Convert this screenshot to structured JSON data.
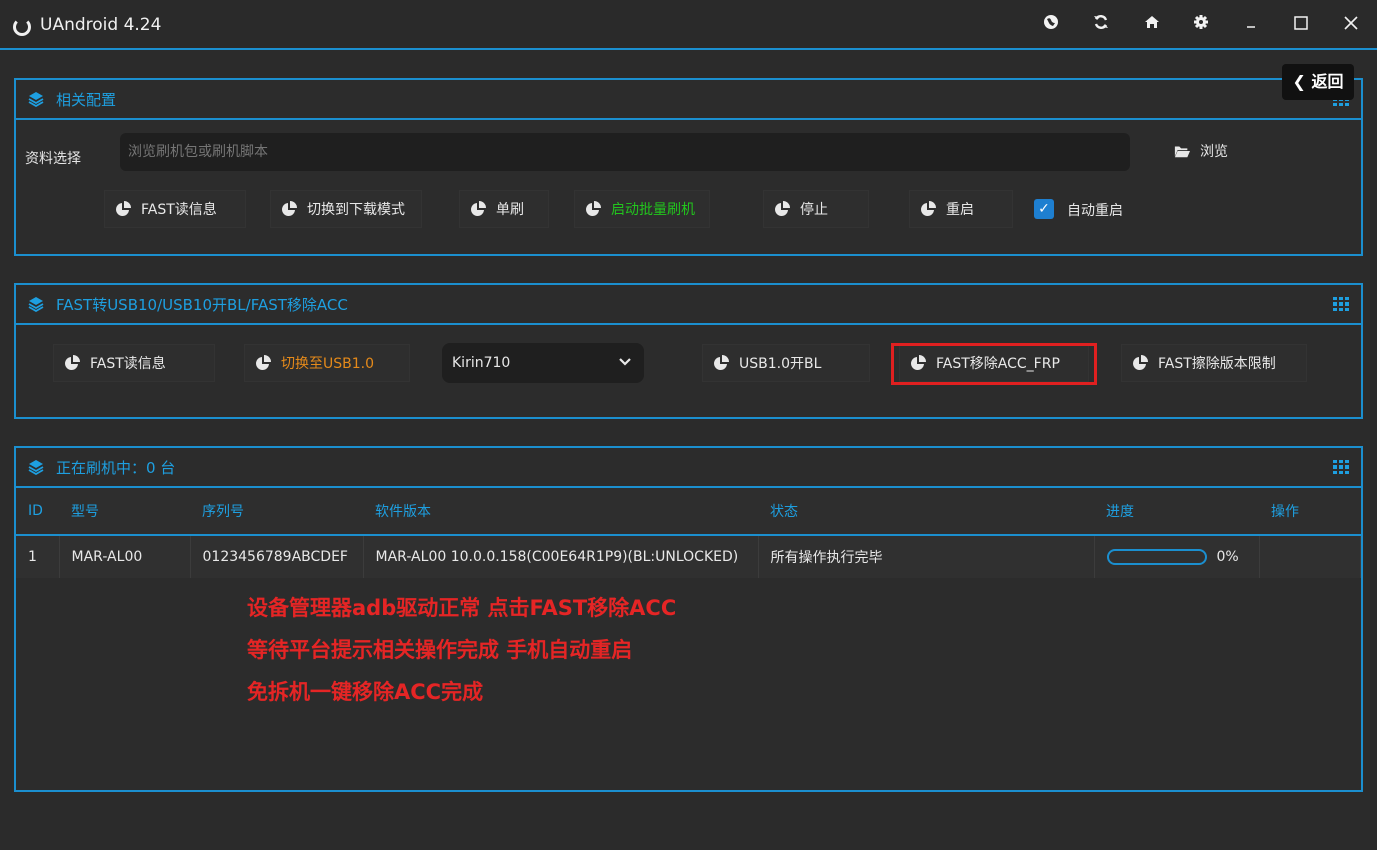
{
  "window": {
    "title": "UAndroid 4.24",
    "controls": [
      "globe-icon",
      "refresh-icon",
      "home-icon",
      "gear-icon",
      "minimize-icon",
      "maximize-icon",
      "close-icon"
    ]
  },
  "back_button": {
    "label": "返回"
  },
  "config_panel": {
    "title": "相关配置",
    "file_label": "资料选择",
    "file_placeholder": "浏览刷机包或刷机脚本",
    "browse_label": "浏览",
    "buttons": [
      "FAST读信息",
      "切换到下载模式",
      "单刷",
      "启动批量刷机",
      "停止",
      "重启"
    ],
    "auto_restart_label": "自动重启",
    "auto_restart_checked": true
  },
  "fast_panel": {
    "title": "FAST转USB10/USB10开BL/FAST移除ACC",
    "buttons": [
      "FAST读信息",
      "切换至USB1.0",
      "USB1.0开BL",
      "FAST移除ACC_FRP",
      "FAST擦除版本限制"
    ],
    "chip_select_value": "Kirin710"
  },
  "flash_panel": {
    "title": "正在刷机中：0 台",
    "columns": [
      "ID",
      "型号",
      "序列号",
      "软件版本",
      "状态",
      "进度",
      "操作"
    ],
    "rows": [
      {
        "id": "1",
        "model": "MAR-AL00",
        "serial": "0123456789ABCDEF",
        "version": "MAR-AL00 10.0.0.158(C00E64R1P9)(BL:UNLOCKED)",
        "status": "所有操作执行完毕",
        "progress_text": "0%",
        "progress_fraction": 0,
        "action": ""
      }
    ]
  },
  "annotations": [
    "设备管理器adb驱动正常 点击FAST移除ACC",
    "等待平台提示相关操作完成 手机自动重启",
    "免拆机一键移除ACC完成"
  ],
  "colors": {
    "accent": "#1b8fcf",
    "title_text": "#1e9fe0",
    "green": "#22c51d",
    "orange": "#e58a1a",
    "annotation_red": "#e52525",
    "highlight_box": "#e02020"
  }
}
